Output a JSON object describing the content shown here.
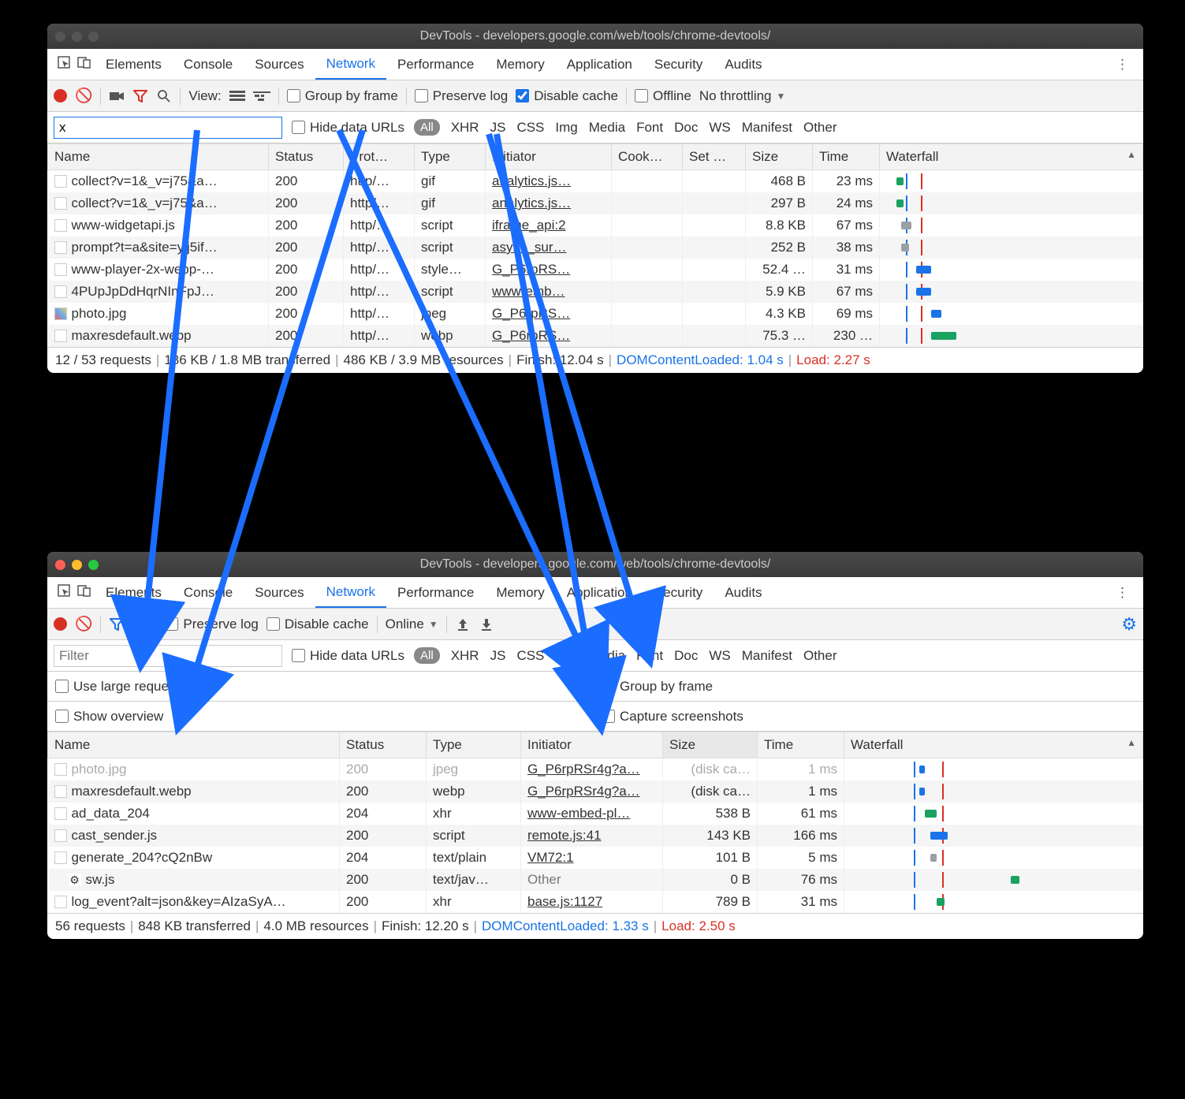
{
  "arrows_color": "#1a6dff",
  "windowA": {
    "title": "DevTools - developers.google.com/web/tools/chrome-devtools/",
    "tabs": [
      "Elements",
      "Console",
      "Sources",
      "Network",
      "Performance",
      "Memory",
      "Application",
      "Security",
      "Audits"
    ],
    "activeTab": "Network",
    "toolbar": {
      "view_label": "View:",
      "group_by_frame": "Group by frame",
      "preserve_log": "Preserve log",
      "disable_cache": "Disable cache",
      "offline": "Offline",
      "throttling": "No throttling"
    },
    "filter_value": "x",
    "hide_data_urls": "Hide data URLs",
    "filter_types": [
      "All",
      "XHR",
      "JS",
      "CSS",
      "Img",
      "Media",
      "Font",
      "Doc",
      "WS",
      "Manifest",
      "Other"
    ],
    "columns": [
      "Name",
      "Status",
      "Prot…",
      "Type",
      "Initiator",
      "Cook…",
      "Set …",
      "Size",
      "Time",
      "Waterfall"
    ],
    "rows": [
      {
        "name": "collect?v=1&_v=j75&a…",
        "status": "200",
        "proto": "http/…",
        "type": "gif",
        "initiator": "analytics.js…",
        "size": "468 B",
        "time": "23 ms",
        "bar": {
          "l": 4,
          "w": 3,
          "c": "#1aa260"
        }
      },
      {
        "name": "collect?v=1&_v=j75&a…",
        "status": "200",
        "proto": "http/…",
        "type": "gif",
        "initiator": "analytics.js…",
        "size": "297 B",
        "time": "24 ms",
        "bar": {
          "l": 4,
          "w": 3,
          "c": "#1aa260"
        }
      },
      {
        "name": "www-widgetapi.js",
        "status": "200",
        "proto": "http/…",
        "type": "script",
        "initiator": "iframe_api:2",
        "size": "8.8 KB",
        "time": "67 ms",
        "bar": {
          "l": 6,
          "w": 4,
          "c": "#9aa0a6"
        }
      },
      {
        "name": "prompt?t=a&site=ylj5if…",
        "status": "200",
        "proto": "http/…",
        "type": "script",
        "initiator": "async_sur…",
        "size": "252 B",
        "time": "38 ms",
        "bar": {
          "l": 6,
          "w": 3,
          "c": "#9aa0a6"
        }
      },
      {
        "name": "www-player-2x-webp-…",
        "status": "200",
        "proto": "http/…",
        "type": "style…",
        "initiator": "G_P6rpRS…",
        "size": "52.4 …",
        "time": "31 ms",
        "bar": {
          "l": 12,
          "w": 6,
          "c": "#1a73e8"
        }
      },
      {
        "name": "4PUpJpDdHqrNInFpJ…",
        "status": "200",
        "proto": "http/…",
        "type": "script",
        "initiator": "www-emb…",
        "size": "5.9 KB",
        "time": "67 ms",
        "bar": {
          "l": 12,
          "w": 6,
          "c": "#1a73e8"
        }
      },
      {
        "name": "photo.jpg",
        "status": "200",
        "proto": "http/…",
        "type": "jpeg",
        "initiator": "G_P6rpRS…",
        "size": "4.3 KB",
        "time": "69 ms",
        "bar": {
          "l": 18,
          "w": 4,
          "c": "#1a73e8"
        }
      },
      {
        "name": "maxresdefault.webp",
        "status": "200",
        "proto": "http/…",
        "type": "webp",
        "initiator": "G_P6rpRS…",
        "size": "75.3 …",
        "time": "230 …",
        "bar": {
          "l": 18,
          "w": 10,
          "c": "#1aa260"
        }
      }
    ],
    "status": {
      "requests": "12 / 53 requests",
      "transferred": "186 KB / 1.8 MB transferred",
      "resources": "486 KB / 3.9 MB resources",
      "finish": "Finish: 12.04 s",
      "dcl_label": "DOMContentLoaded:",
      "dcl_value": "1.04 s",
      "load_label": "Load:",
      "load_value": "2.27 s"
    }
  },
  "windowB": {
    "title": "DevTools - developers.google.com/web/tools/chrome-devtools/",
    "tabs": [
      "Elements",
      "Console",
      "Sources",
      "Network",
      "Performance",
      "Memory",
      "Application",
      "Security",
      "Audits"
    ],
    "activeTab": "Network",
    "toolbar": {
      "preserve_log": "Preserve log",
      "disable_cache": "Disable cache",
      "online": "Online"
    },
    "filter_placeholder": "Filter",
    "hide_data_urls": "Hide data URLs",
    "filter_types": [
      "All",
      "XHR",
      "JS",
      "CSS",
      "Img",
      "Media",
      "Font",
      "Doc",
      "WS",
      "Manifest",
      "Other"
    ],
    "settings": {
      "large_rows": "Use large request rows",
      "show_overview": "Show overview",
      "group_by_frame": "Group by frame",
      "capture_screenshots": "Capture screenshots"
    },
    "columns": [
      "Name",
      "Status",
      "Type",
      "Initiator",
      "Size",
      "Time",
      "Waterfall"
    ],
    "rows": [
      {
        "name": "photo.jpg",
        "status": "200",
        "type": "jpeg",
        "initiator": "G_P6rpRSr4g?a…",
        "size": "(disk ca…",
        "time": "1 ms",
        "faded": true,
        "bar": {
          "l": 24,
          "w": 2,
          "c": "#1a73e8"
        }
      },
      {
        "name": "maxresdefault.webp",
        "status": "200",
        "type": "webp",
        "initiator": "G_P6rpRSr4g?a…",
        "size": "(disk ca…",
        "time": "1 ms",
        "bar": {
          "l": 24,
          "w": 2,
          "c": "#1a73e8"
        }
      },
      {
        "name": "ad_data_204",
        "status": "204",
        "type": "xhr",
        "initiator": "www-embed-pl…",
        "size": "538 B",
        "time": "61 ms",
        "bar": {
          "l": 26,
          "w": 4,
          "c": "#1aa260"
        }
      },
      {
        "name": "cast_sender.js",
        "status": "200",
        "type": "script",
        "initiator": "remote.js:41",
        "size": "143 KB",
        "time": "166 ms",
        "bar": {
          "l": 28,
          "w": 6,
          "c": "#1a73e8"
        }
      },
      {
        "name": "generate_204?cQ2nBw",
        "status": "204",
        "type": "text/plain",
        "initiator": "VM72:1",
        "size": "101 B",
        "time": "5 ms",
        "bar": {
          "l": 28,
          "w": 2,
          "c": "#9aa0a6"
        }
      },
      {
        "name": "sw.js",
        "status": "200",
        "type": "text/jav…",
        "initiator": "Other",
        "size": "0 B",
        "time": "76 ms",
        "gear": true,
        "noul": true,
        "bar": {
          "l": 56,
          "w": 3,
          "c": "#1aa260"
        }
      },
      {
        "name": "log_event?alt=json&key=AIzaSyA…",
        "status": "200",
        "type": "xhr",
        "initiator": "base.js:1127",
        "size": "789 B",
        "time": "31 ms",
        "bar": {
          "l": 30,
          "w": 3,
          "c": "#1aa260"
        }
      }
    ],
    "status": {
      "requests": "56 requests",
      "transferred": "848 KB transferred",
      "resources": "4.0 MB resources",
      "finish": "Finish: 12.20 s",
      "dcl_label": "DOMContentLoaded:",
      "dcl_value": "1.33 s",
      "load_label": "Load:",
      "load_value": "2.50 s"
    }
  }
}
